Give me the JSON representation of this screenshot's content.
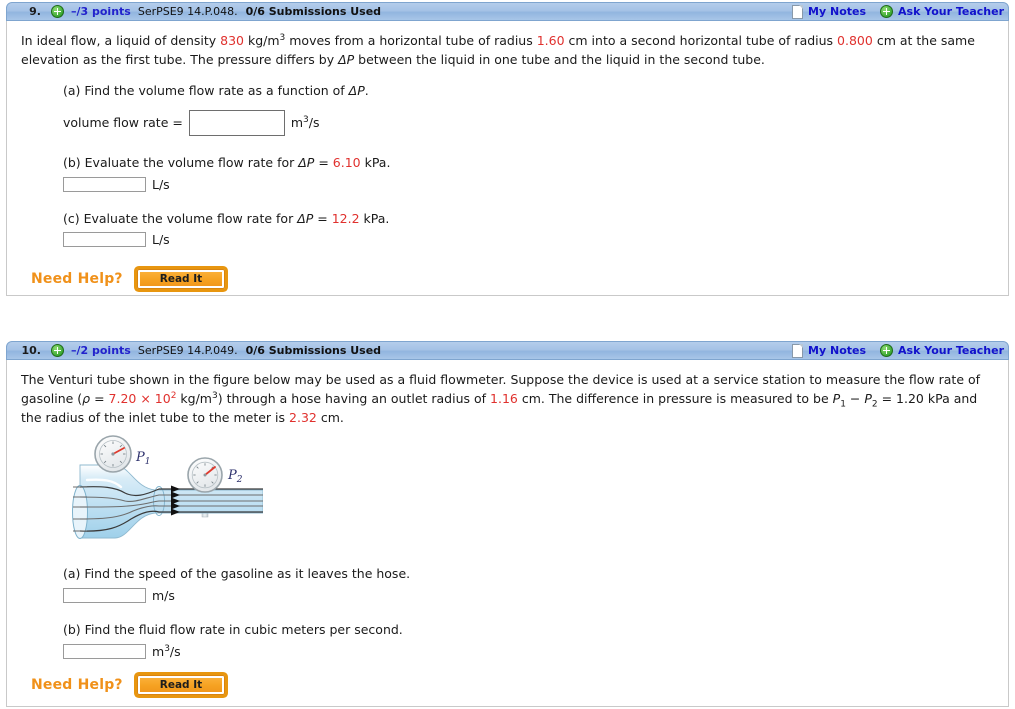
{
  "colors": {
    "value_red": "#e0312e",
    "link_blue": "#1111cc",
    "header_blue": "#a5c2e6",
    "need_help_orange": "#f0911a",
    "button_orange": "#f6a323"
  },
  "questions": [
    {
      "number": "9.",
      "points": "–/3 points",
      "code": "SerPSE9 14.P.048.",
      "submissions": "0/6 Submissions Used",
      "my_notes": "My Notes",
      "ask_teacher": "Ask Your Teacher",
      "stem": {
        "t1": "In ideal flow, a liquid of density ",
        "density": "830",
        "t2": " kg/m",
        "exp1": "3",
        "t3": " moves from a horizontal tube of radius ",
        "r1": "1.60",
        "t4": " cm into a second horizontal tube of radius ",
        "r2": "0.800",
        "t5": " cm at the same elevation as the first tube. The pressure differs by ",
        "dp": "ΔP",
        "t6": " between the liquid in one tube and the liquid in the second tube."
      },
      "parts": [
        {
          "prompt_pre": "(a) Find the volume flow rate as a function of ",
          "prompt_sym": "ΔP",
          "prompt_post": ".",
          "inline_label": "volume flow rate =",
          "input_value": "",
          "unit_pre": "m",
          "unit_sup": "3",
          "unit_post": "/s",
          "box": "big"
        },
        {
          "prompt_pre": "(b) Evaluate the volume flow rate for ",
          "prompt_sym": "ΔP",
          "prompt_eq": " = ",
          "prompt_val": "6.10",
          "prompt_post": " kPa.",
          "input_value": "",
          "unit_pre": "L/s",
          "unit_sup": "",
          "unit_post": "",
          "box": "small"
        },
        {
          "prompt_pre": "(c) Evaluate the volume flow rate for ",
          "prompt_sym": "ΔP",
          "prompt_eq": " = ",
          "prompt_val": "12.2",
          "prompt_post": " kPa.",
          "input_value": "",
          "unit_pre": "L/s",
          "unit_sup": "",
          "unit_post": "",
          "box": "small"
        }
      ],
      "need_help": "Need Help?",
      "read_it": "Read It"
    },
    {
      "number": "10.",
      "points": "–/2 points",
      "code": "SerPSE9 14.P.049.",
      "submissions": "0/6 Submissions Used",
      "my_notes": "My Notes",
      "ask_teacher": "Ask Your Teacher",
      "stem": {
        "t1": "The Venturi tube shown in the figure below may be used as a fluid flowmeter. Suppose the device is used at a service station to measure the flow rate of gasoline (",
        "rho": "ρ",
        "t2": " = ",
        "dens1": "7.20 × 10",
        "dens_exp": "2",
        "t3": " kg/m",
        "exp1": "3",
        "t4": ") through a hose having an outlet radius of ",
        "r_out": "1.16",
        "t5": " cm. The difference in pressure is measured to be ",
        "p1": "P",
        "p1sub": "1",
        "t6": " − ",
        "p2": "P",
        "p2sub": "2",
        "t7": " = 1.20 kPa and the radius of the inlet tube to the meter is ",
        "r_in": "2.32",
        "t8": " cm."
      },
      "figure": {
        "label_p1": "P",
        "label_p1_sub": "1",
        "label_p2": "P",
        "label_p2_sub": "2",
        "alt": "venturi-tube-diagram"
      },
      "parts": [
        {
          "prompt_pre": "(a) Find the speed of the gasoline as it leaves the hose.",
          "prompt_sym": "",
          "prompt_post": "",
          "input_value": "",
          "unit_pre": "m/s",
          "unit_sup": "",
          "unit_post": "",
          "box": "small"
        },
        {
          "prompt_pre": "(b) Find the fluid flow rate in cubic meters per second.",
          "prompt_sym": "",
          "prompt_post": "",
          "input_value": "",
          "unit_pre": "m",
          "unit_sup": "3",
          "unit_post": "/s",
          "box": "small"
        }
      ],
      "need_help": "Need Help?",
      "read_it": "Read It"
    }
  ]
}
